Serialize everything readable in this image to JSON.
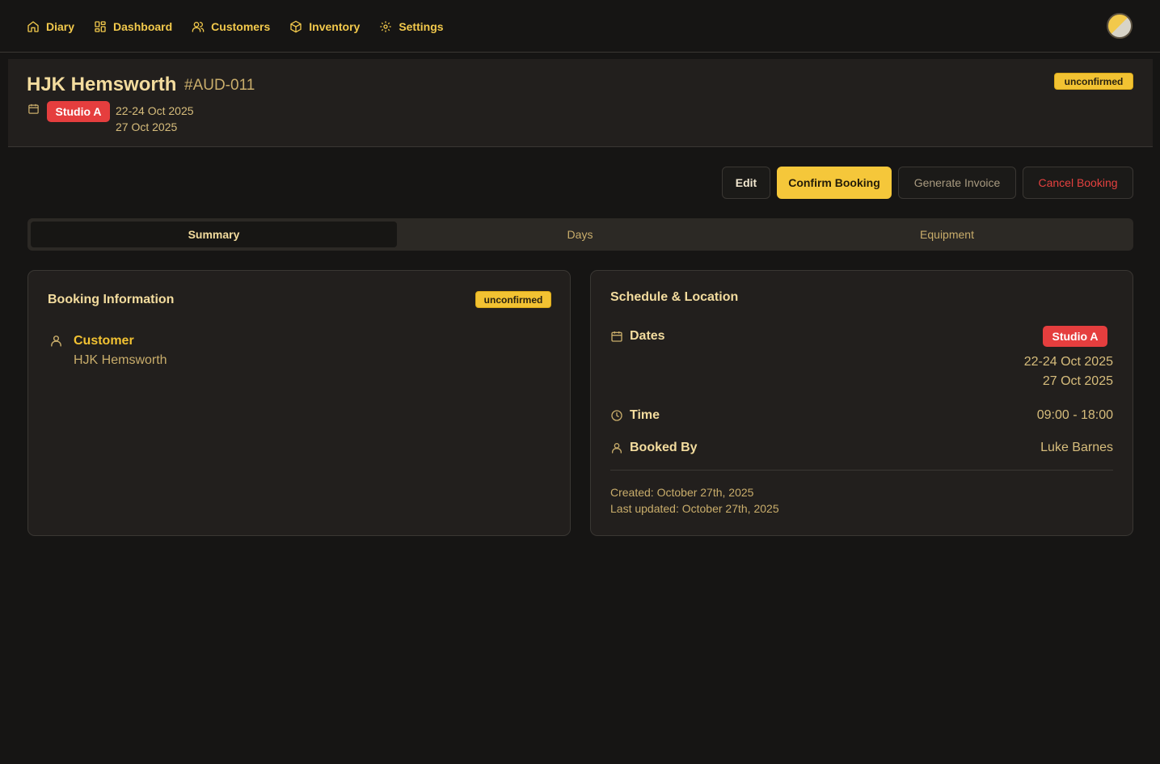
{
  "nav": {
    "items": [
      {
        "label": "Diary",
        "icon": "home-icon"
      },
      {
        "label": "Dashboard",
        "icon": "dashboard-icon"
      },
      {
        "label": "Customers",
        "icon": "users-icon"
      },
      {
        "label": "Inventory",
        "icon": "box-icon"
      },
      {
        "label": "Settings",
        "icon": "gear-icon"
      }
    ]
  },
  "booking": {
    "title": "HJK Hemsworth",
    "ref": "#AUD-011",
    "studio": "Studio A",
    "date_line_1": "22-24 Oct 2025",
    "date_line_2": "27 Oct 2025",
    "status": "unconfirmed"
  },
  "actions": {
    "edit": "Edit",
    "confirm": "Confirm Booking",
    "invoice": "Generate Invoice",
    "cancel": "Cancel Booking"
  },
  "tabs": [
    "Summary",
    "Days",
    "Equipment"
  ],
  "booking_info": {
    "title": "Booking Information",
    "status": "unconfirmed",
    "customer_label": "Customer",
    "customer_name": "HJK Hemsworth"
  },
  "schedule": {
    "title": "Schedule & Location",
    "dates_label": "Dates",
    "studio": "Studio A",
    "date_line_1": "22-24 Oct 2025",
    "date_line_2": "27 Oct 2025",
    "time_label": "Time",
    "time_value": "09:00 - 18:00",
    "booked_by_label": "Booked By",
    "booked_by_value": "Luke Barnes",
    "created": "Created: October 27th, 2025",
    "updated": "Last updated: October 27th, 2025"
  },
  "colors": {
    "accent": "#f2c232",
    "danger": "#e53e3e",
    "background": "#161514",
    "card": "#221f1d"
  }
}
